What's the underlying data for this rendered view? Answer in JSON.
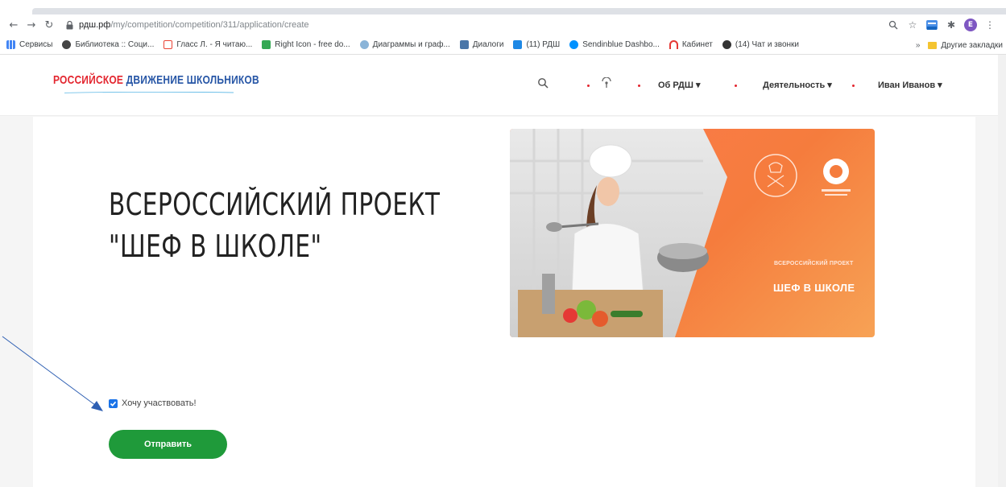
{
  "browser": {
    "url_domain": "рдш.рф",
    "url_path": "/my/competition/competition/311/application/create",
    "bookmarks": [
      {
        "label": "Сервисы",
        "color": "#4285f4"
      },
      {
        "label": "Библиотека :: Соци...",
        "color": "#444444"
      },
      {
        "label": "Гласс Л. - Я читаю...",
        "color": "#ea4335"
      },
      {
        "label": "Right Icon - free do...",
        "color": "#34a853"
      },
      {
        "label": "Диаграммы и граф...",
        "color": "#5f6368"
      },
      {
        "label": "Диалоги",
        "color": "#4a76a8"
      },
      {
        "label": "(11) РДШ",
        "color": "#1e88e5"
      },
      {
        "label": "Sendinblue Dashbo...",
        "color": "#0092ff"
      },
      {
        "label": "Кабинет",
        "color": "#e53935"
      },
      {
        "label": "(14) Чат и звонки",
        "color": "#333333"
      }
    ],
    "other_bookmarks": "Другие закладки",
    "profile_initial": "E"
  },
  "site": {
    "logo_word1": "РОССИЙСКОЕ",
    "logo_word2": "ДВИЖЕНИЕ ШКОЛЬНИКОВ",
    "menu": {
      "about": "Об РДШ ▾",
      "activity": "Деятельность ▾",
      "user": "Иван Иванов ▾"
    }
  },
  "project": {
    "title_line1": "ВСЕРОССИЙСКИЙ ПРОЕКТ",
    "title_line2": "\"ШЕФ В ШКОЛЕ\"",
    "banner_small": "ВСЕРОССИЙСКИЙ ПРОЕКТ",
    "banner_big": "ШЕФ В ШКОЛЕ"
  },
  "form": {
    "checkbox_label": "Хочу участвовать!",
    "checkbox_checked": true,
    "submit_label": "Отправить"
  },
  "colors": {
    "accent_red": "#e3262f",
    "accent_blue": "#2756a6",
    "button_green": "#1f9a3a",
    "banner_orange": "#f57c3d"
  }
}
